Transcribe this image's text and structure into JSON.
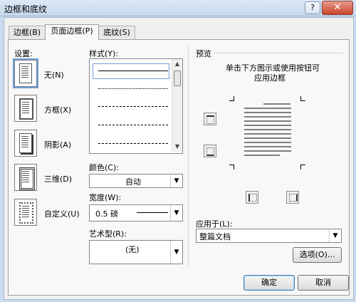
{
  "window": {
    "title": "边框和底纹",
    "help_label": "?",
    "close_label": "✕"
  },
  "tabs": [
    {
      "label": "边框(B)",
      "active": false
    },
    {
      "label": "页面边框(P)",
      "active": true
    },
    {
      "label": "底纹(S)",
      "active": false
    }
  ],
  "settings": {
    "title": "设置:",
    "items": [
      {
        "label": "无(N)",
        "icon": "page-none-icon",
        "selected": true
      },
      {
        "label": "方框(X)",
        "icon": "page-box-icon",
        "selected": false
      },
      {
        "label": "阴影(A)",
        "icon": "page-shadow-icon",
        "selected": false
      },
      {
        "label": "三维(D)",
        "icon": "page-3d-icon",
        "selected": false
      },
      {
        "label": "自定义(U)",
        "icon": "page-custom-icon",
        "selected": false
      }
    ]
  },
  "style": {
    "title": "样式(Y):",
    "options": [
      "solid",
      "dotted",
      "dashed",
      "dash",
      "dash-dot",
      "dash-long"
    ]
  },
  "color": {
    "label": "颜色(C):",
    "value": "自动"
  },
  "width": {
    "label": "宽度(W):",
    "value": "0.5 磅"
  },
  "art": {
    "label": "艺术型(R):",
    "value": "(无)"
  },
  "preview": {
    "title": "预览",
    "hint_line1": "单击下方图示或使用按钮可",
    "hint_line2": "应用边框"
  },
  "apply_to": {
    "label": "应用于(L):",
    "value": "整篇文档"
  },
  "buttons": {
    "options": "选项(O)...",
    "ok": "确定",
    "cancel": "取消"
  },
  "colors": {
    "accent": "#3c7fb1",
    "titlebar": "#c6d8ec",
    "close": "#c9452d"
  }
}
